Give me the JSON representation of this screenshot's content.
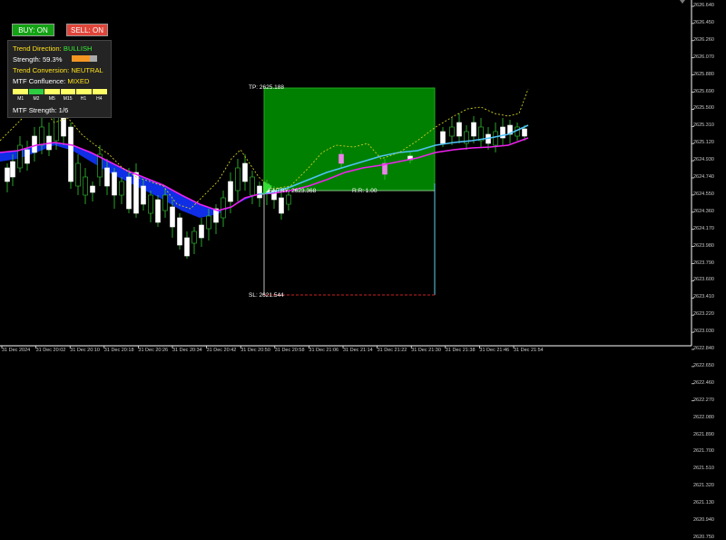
{
  "buttons": {
    "buy": "BUY: ON",
    "sell": "SELL: ON"
  },
  "panel": {
    "trend_direction_label": "Trend Direction:",
    "trend_direction_value": "BULLISH",
    "strength_label": "Strength:",
    "strength_value": "59.3%",
    "strength_fraction": 0.72,
    "trend_conversion_label": "Trend Conversion:",
    "trend_conversion_value": "NEUTRAL",
    "mtf_confluence_label": "MTF Confluence:",
    "mtf_confluence_value": "MIXED",
    "timeframes": [
      {
        "name": "M1",
        "color": "#ffff66"
      },
      {
        "name": "M2",
        "color": "#2ecc40"
      },
      {
        "name": "M5",
        "color": "#ffff66"
      },
      {
        "name": "M15",
        "color": "#ffff66"
      },
      {
        "name": "H1",
        "color": "#ffff66"
      },
      {
        "name": "H4",
        "color": "#ffff66"
      }
    ],
    "mtf_strength_label": "MTF Strength:",
    "mtf_strength_value": "1/6"
  },
  "trade": {
    "tp_label": "TP: 2625.188",
    "entry_label": "ENTRY: 2623.368",
    "rr_label": "R:R: 1.00",
    "sl_label": "SL: 2621.544",
    "tp": 2625.188,
    "entry": 2623.368,
    "sl": 2621.544
  },
  "y_axis": [
    "2626.640",
    "2626.450",
    "2626.260",
    "2626.070",
    "2625.880",
    "2625.690",
    "2625.500",
    "2625.310",
    "2625.120",
    "2624.930",
    "2624.740",
    "2624.550",
    "2624.360",
    "2624.170",
    "2623.980",
    "2623.790",
    "2623.600",
    "2623.410",
    "2623.220",
    "2623.030",
    "2622.840",
    "2622.650",
    "2622.460",
    "2622.270",
    "2622.080",
    "2621.890",
    "2621.700",
    "2621.510",
    "2621.320",
    "2621.130",
    "2620.940",
    "2620.750"
  ],
  "x_axis": [
    "31 Dec 2024",
    "31 Dec 20:02",
    "31 Dec 20:10",
    "31 Dec 20:18",
    "31 Dec 20:26",
    "31 Dec 20:34",
    "31 Dec 20:42",
    "31 Dec 20:50",
    "31 Dec 20:58",
    "31 Dec 21:06",
    "31 Dec 21:14",
    "31 Dec 21:22",
    "31 Dec 21:30",
    "31 Dec 21:38",
    "31 Dec 21:46",
    "31 Dec 21:54"
  ],
  "colors": {
    "bull_candle": "#ffffff",
    "bear_candle": "#000000",
    "wick_bull": "#33cc33",
    "wick_bear": "#33cc33",
    "pink_candle": "#ee82ee",
    "ema_fast": "#4fc3f7",
    "ema_slow": "#ee22ee",
    "cloud": "#1133ff",
    "tp_box": "#008000",
    "dotted_line": "#cccc22",
    "sl_line": "#cc2222"
  }
}
